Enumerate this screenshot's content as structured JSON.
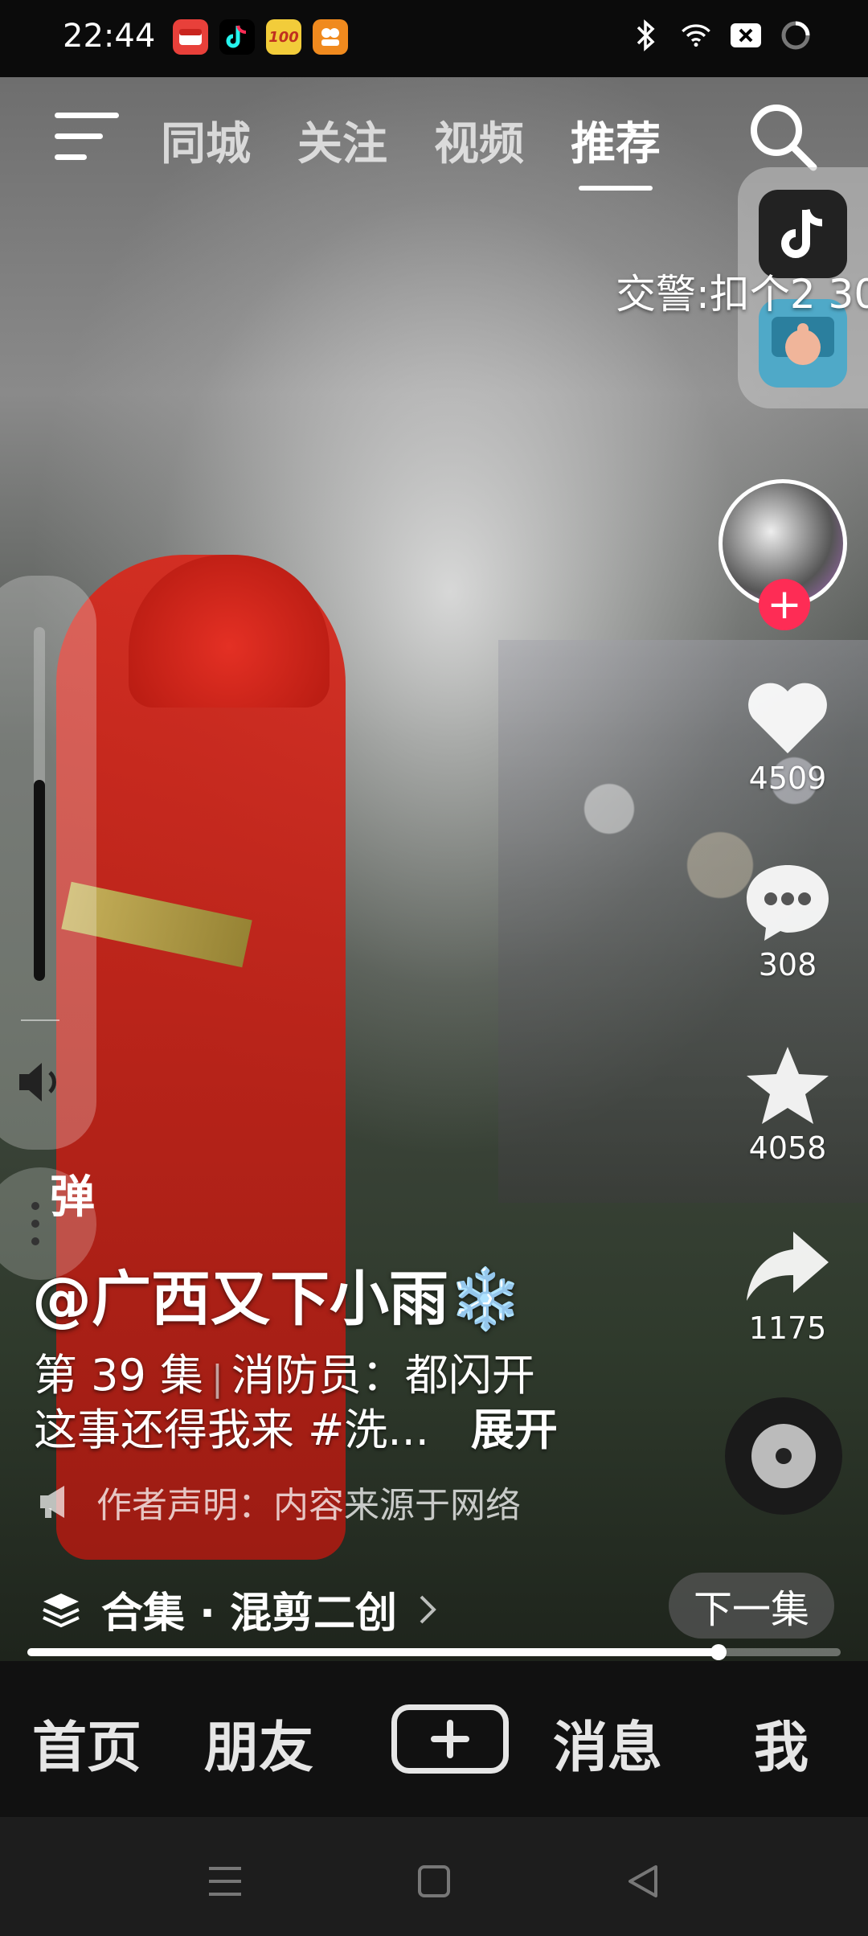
{
  "status": {
    "time": "22:44",
    "apps": [
      {
        "name": "red-packet-app-icon",
        "bg": "#e8403a",
        "glyph": "▬"
      },
      {
        "name": "tiktok-app-icon",
        "bg": "#000000",
        "glyph": "♪"
      },
      {
        "name": "yellow-app-icon",
        "bg": "#f2cc3a",
        "glyph": "100"
      },
      {
        "name": "orange-app-icon",
        "bg": "#f08a1e",
        "glyph": "88"
      }
    ],
    "battery_label": "✕"
  },
  "top_tabs": [
    "同城",
    "关注",
    "视频",
    "推荐"
  ],
  "active_tab": "推荐",
  "danmaku": "交警:扣个2 30",
  "rail": {
    "likes": "4509",
    "comments": "308",
    "favorites": "4058",
    "shares": "1175"
  },
  "side": {
    "danmu_label": "弹"
  },
  "caption": {
    "author": "@广西又下小雨❄️",
    "episode": "第 39 集",
    "episode_title": "消防员：都闪开",
    "line2": "这事还得我来 #洗...",
    "expand": "展开",
    "disclaimer": "作者声明：内容来源于网络",
    "collection": "合集 · 混剪二创",
    "next_episode": "下一集"
  },
  "progress": 0.85,
  "bottom_nav": [
    "首页",
    "朋友",
    "消息",
    "我"
  ],
  "colors": {
    "accent": "#fe2c55",
    "tiktok_red": "#fe2c55"
  }
}
